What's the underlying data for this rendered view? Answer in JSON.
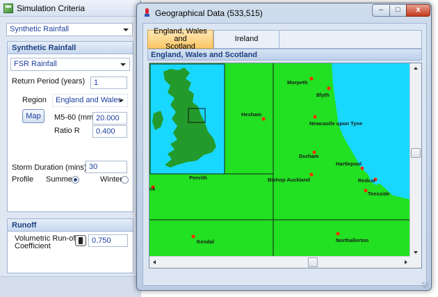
{
  "simulation": {
    "title": "Simulation Criteria",
    "rainfall_type": "Synthetic Rainfall",
    "synthetic_group": {
      "header": "Synthetic Rainfall",
      "method": "FSR Rainfall",
      "return_period_label": "Return Period (years)",
      "return_period_value": "1",
      "region_label": "Region",
      "region_value": "England and Wales",
      "map_button": "Map",
      "m5_label": "M5-60 (mm)",
      "m5_value": "20.000",
      "ratio_label": "Ratio R",
      "ratio_value": "0.400",
      "storm_duration_label": "Storm Duration (mins)",
      "storm_duration_value": "30",
      "profile_label": "Profile",
      "profile_summer": "Summer",
      "profile_winter": "Winter",
      "profile_selected": "Summer"
    },
    "runoff_group": {
      "header": "Runoff",
      "coefficient_label_line1": "Volumetric Run-off",
      "coefficient_label_line2": "Coefficient",
      "coefficient_value": "0.750"
    }
  },
  "geo": {
    "title": "Geographical Data (533,515)",
    "window_buttons": {
      "minimize": "–",
      "maximize": "□",
      "close": "x"
    },
    "tabs": [
      {
        "label_line1": "England, Wales and",
        "label_line2": "Scotland",
        "active": true
      },
      {
        "label": "Ireland",
        "active": false
      }
    ],
    "band_label": "England, Wales and Scotland",
    "map": {
      "colors": {
        "land": "#22e022",
        "sea": "#19d8ff",
        "town_dot": "#ff2a00",
        "grid": "#1a1a1a",
        "overview_land": "#239a2b"
      },
      "places": [
        {
          "name": "Morpeth"
        },
        {
          "name": "Blyth"
        },
        {
          "name": "Hexham"
        },
        {
          "name": "Newcastle upon Tyne"
        },
        {
          "name": "Durham"
        },
        {
          "name": "Hartlepool"
        },
        {
          "name": "Penrith"
        },
        {
          "name": "Bishop Auckland"
        },
        {
          "name": "Redcar"
        },
        {
          "name": "Teesside"
        },
        {
          "name": "Kendal"
        },
        {
          "name": "Northallerton"
        },
        {
          "name": "ck"
        }
      ]
    }
  }
}
